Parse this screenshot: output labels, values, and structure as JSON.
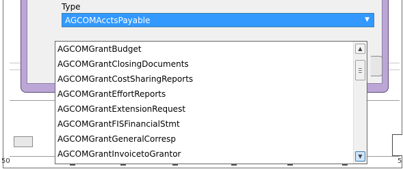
{
  "dialog": {
    "type_label": "Type",
    "selected_value": "AGCOMAcctsPayable"
  },
  "dropdown": {
    "items": [
      "AGCOMGrantBudget",
      "AGCOMGrantClosingDocuments",
      "AGCOMGrantCostSharingReports",
      "AGCOMGrantEffortReports",
      "AGCOMGrantExtensionRequest",
      "AGCOMGrantFISFinancialStmt",
      "AGCOMGrantGeneralCorresp",
      "AGCOMGrantInvoicetoGrantor"
    ]
  },
  "background": {
    "ruler_left": "50",
    "ruler_right": "5"
  },
  "icons": {
    "combo_arrow": "chevron-down-icon",
    "scroll_up": "arrow-up-icon",
    "scroll_down": "arrow-down-icon"
  },
  "colors": {
    "selection": "#3399ff",
    "dialog_frame": "#bba6d6"
  }
}
